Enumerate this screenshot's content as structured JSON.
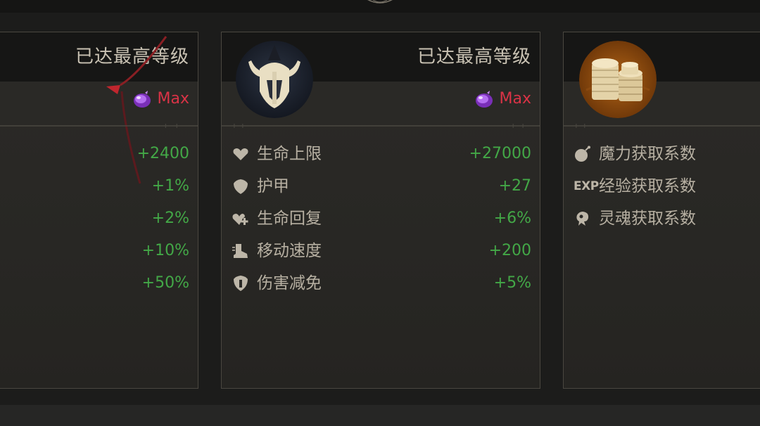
{
  "cards": {
    "left": {
      "level_status": "已达最高等级",
      "max_label": "Max",
      "stats": [
        "+2400",
        "+1%",
        "+2%",
        "+10%",
        "+50%"
      ]
    },
    "middle": {
      "avatar": "horned-helmet-icon",
      "level_status": "已达最高等级",
      "max_label": "Max",
      "stats": [
        {
          "icon": "heart-icon",
          "label": "生命上限",
          "value": "+27000"
        },
        {
          "icon": "shield-icon",
          "label": "护甲",
          "value": "+27"
        },
        {
          "icon": "heart-plus-icon",
          "label": "生命回复",
          "value": "+6%"
        },
        {
          "icon": "boot-icon",
          "label": "移动速度",
          "value": "+200"
        },
        {
          "icon": "armor-shield-icon",
          "label": "伤害减免",
          "value": "+5%"
        }
      ]
    },
    "right": {
      "avatar": "coin-stack-icon",
      "stats": [
        {
          "icon": "mana-bomb-icon",
          "label": "魔力获取系数"
        },
        {
          "icon": "exp-icon",
          "icon_text": "EXP",
          "label": "经验获取系数"
        },
        {
          "icon": "soul-icon",
          "label": "灵魂获取系数"
        }
      ]
    }
  },
  "colors": {
    "background": "#1c1c1b",
    "card": "#2a2926",
    "card_border": "#4a4740",
    "header": "#161615",
    "max_red": "#d93346",
    "value_green": "#43a847",
    "label": "#b7b0a2",
    "level_text": "#c9c2b3"
  }
}
